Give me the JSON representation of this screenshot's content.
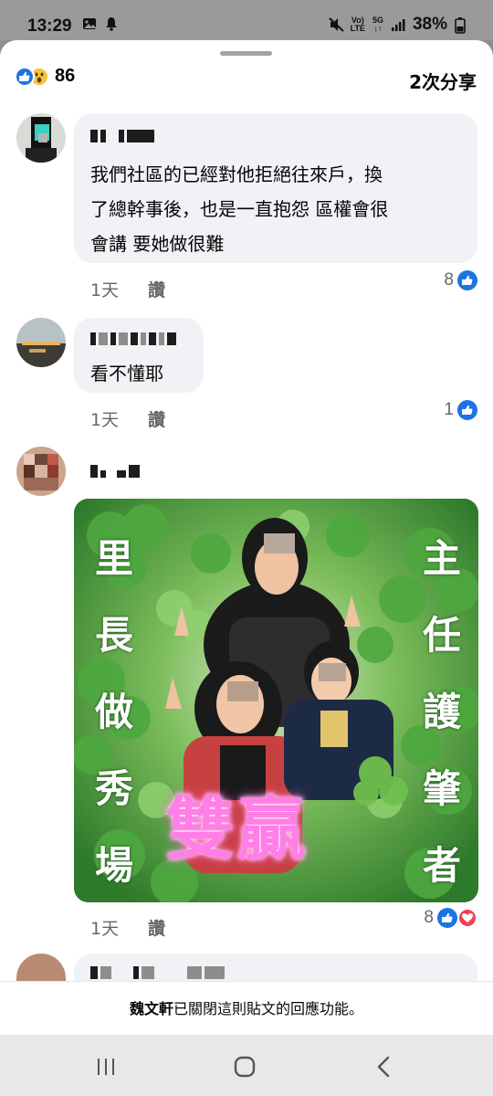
{
  "status_bar": {
    "time": "13:29",
    "network_top": "Vo)",
    "network_bottom": "LTE",
    "net5g_top": "5G",
    "net5g_bottom": "↓↑",
    "battery": "38%",
    "icons": [
      "gallery-icon",
      "notification-bell-icon",
      "mute-icon",
      "signal-icon",
      "battery-icon"
    ]
  },
  "post": {
    "reaction_count": "86",
    "reaction_icons": [
      "like-icon",
      "wow-icon"
    ],
    "share_count": "2次分享"
  },
  "comments": [
    {
      "text": "我們社區的已經對他拒絕往來戶，換了總幹事後，也是一直抱怨 區權會很會講 要她做很難",
      "line1": "我們社區的已經對他拒絕往來戶，換",
      "line2": "了總幹事後，也是一直抱怨 區權會很",
      "line3": "會講 要她做很難",
      "time": "1天",
      "like_label": "讚",
      "reaction_count": "8"
    },
    {
      "text": "看不懂耶",
      "time": "1天",
      "like_label": "讚",
      "reaction_count": "1"
    },
    {
      "time": "1天",
      "like_label": "讚",
      "reaction_count": "8",
      "image": {
        "left_text": [
          "里",
          "長",
          "做",
          "秀",
          "場"
        ],
        "right_text": [
          "主",
          "任",
          "護",
          "肇",
          "者"
        ],
        "center_text": "雙贏"
      }
    }
  ],
  "closed_notice": {
    "name": "魏文軒",
    "text": "已關閉這則貼文的回應功能。"
  },
  "nav": [
    "recent-apps-button",
    "home-button",
    "back-button"
  ],
  "colors": {
    "accent": "#1b74e4",
    "bubble": "#f0f2f5",
    "meta_text": "#65676b",
    "love": "#f33e58",
    "meme_pink": "#ff7ee7"
  }
}
